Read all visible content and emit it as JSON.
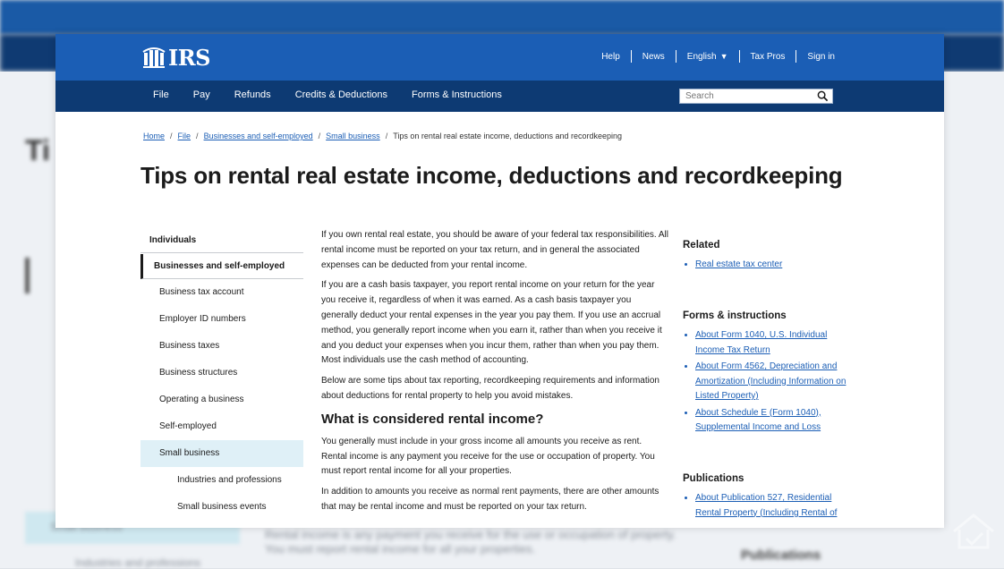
{
  "header": {
    "logo_text": "IRS",
    "links": [
      {
        "label": "Help"
      },
      {
        "label": "News"
      },
      {
        "label": "English"
      },
      {
        "label": "Tax Pros"
      },
      {
        "label": "Sign in"
      }
    ]
  },
  "nav": {
    "items": [
      "File",
      "Pay",
      "Refunds",
      "Credits & Deductions",
      "Forms & Instructions"
    ],
    "search_placeholder": "Search"
  },
  "breadcrumb": [
    "Home",
    "File",
    "Businesses and self-employed",
    "Small business",
    "Tips on rental real estate income, deductions and recordkeeping"
  ],
  "page_title": "Tips on rental real estate income, deductions and recordkeeping",
  "sidebar": {
    "top": "Individuals",
    "active": "Businesses and self-employed",
    "items": [
      "Business tax account",
      "Employer ID numbers",
      "Business taxes",
      "Business structures",
      "Operating a business",
      "Self-employed",
      "Small business"
    ],
    "sub_items": [
      "Industries and professions",
      "Small business events"
    ]
  },
  "content": {
    "p1": "If you own rental real estate, you should be aware of your federal tax responsibilities. All rental income must be reported on your tax return, and in general the associated expenses can be deducted from your rental income.",
    "p2": "If you are a cash basis taxpayer, you report rental income on your return for the year you receive it, regardless of when it was earned. As a cash basis taxpayer you generally deduct your rental expenses in the year you pay them. If you use an accrual method, you generally report income when you earn it, rather than when you receive it and you deduct your expenses when you incur them, rather than when you pay them. Most individuals use the cash method of accounting.",
    "p3": "Below are some tips about tax reporting, recordkeeping requirements and information about deductions for rental property to help you avoid mistakes.",
    "h2": "What is considered rental income?",
    "p4": "You generally must include in your gross income all amounts you receive as rent. Rental income is any payment you receive for the use or occupation of property. You must report rental income for all your properties.",
    "p5": "In addition to amounts you receive as normal rent payments, there are other amounts that may be rental income and must be reported on your tax return."
  },
  "related": {
    "heading": "Related",
    "links": [
      "Real estate tax center"
    ]
  },
  "forms": {
    "heading": "Forms & instructions",
    "links": [
      "About Form 1040, U.S. Individual Income Tax Return",
      "About Form 4562, Depreciation and Amortization (Including Information on Listed Property)",
      "About Schedule E (Form 1040), Supplemental Income and Loss"
    ]
  },
  "publications": {
    "heading": "Publications",
    "links": [
      "About Publication 527, Residential Rental Property (Including Rental of"
    ]
  },
  "background": {
    "title_fragment": "Ti",
    "line1": "Rental income is any payment you receive for the use or occupation of property.",
    "line2": "You must report rental income for all your properties.",
    "pubs": "Publications",
    "sidebar_small_business": "Small business",
    "sidebar_industries": "Industries and professions"
  },
  "colors": {
    "brand_blue": "#1b5eb5",
    "nav_dark": "#0d3a73",
    "highlight": "#dff0f7"
  }
}
